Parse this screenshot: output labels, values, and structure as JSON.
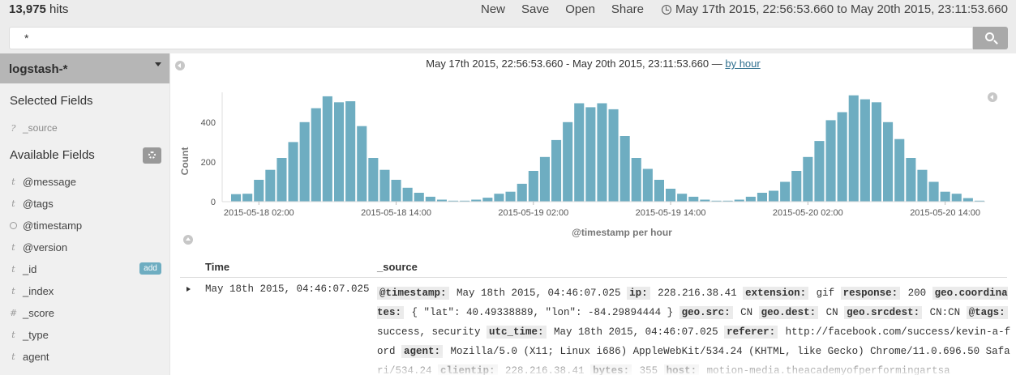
{
  "topbar": {
    "hits_count": "13,975",
    "hits_label": " hits",
    "actions": [
      "New",
      "Save",
      "Open",
      "Share"
    ],
    "time_range": "May 17th 2015, 22:56:53.660 to May 20th 2015, 23:11:53.660"
  },
  "search": {
    "query": "*"
  },
  "sidebar": {
    "index_pattern": "logstash-*",
    "selected_title": "Selected Fields",
    "selected_fields": [
      {
        "type": "?",
        "name": "_source"
      }
    ],
    "available_title": "Available Fields",
    "add_label": "add",
    "fields": [
      {
        "type": "t",
        "name": "@message"
      },
      {
        "type": "t",
        "name": "@tags"
      },
      {
        "type": "clock",
        "name": "@timestamp"
      },
      {
        "type": "t",
        "name": "@version"
      },
      {
        "type": "t",
        "name": "_id"
      },
      {
        "type": "t",
        "name": "_index"
      },
      {
        "type": "#",
        "name": "_score"
      },
      {
        "type": "t",
        "name": "_type"
      },
      {
        "type": "t",
        "name": "agent"
      }
    ]
  },
  "chart_header": {
    "range": "May 17th 2015, 22:56:53.660 - May 20th 2015, 23:11:53.660",
    "separator": " — ",
    "interval": "by hour"
  },
  "chart_data": {
    "type": "bar",
    "color": "#6eadc1",
    "title": "",
    "xlabel": "@timestamp per hour",
    "ylabel": "Count",
    "ylim": [
      0,
      550
    ],
    "yticks": [
      0,
      200,
      400
    ],
    "x_tick_labels": [
      "2015-05-18 02:00",
      "2015-05-18 14:00",
      "2015-05-19 02:00",
      "2015-05-19 14:00",
      "2015-05-20 02:00",
      "2015-05-20 14:00"
    ],
    "x_tick_positions": [
      2,
      14,
      26,
      38,
      50,
      62
    ],
    "values": [
      38,
      40,
      110,
      160,
      220,
      300,
      400,
      470,
      530,
      500,
      505,
      380,
      220,
      160,
      110,
      70,
      45,
      25,
      10,
      5,
      5,
      10,
      20,
      40,
      50,
      90,
      155,
      225,
      310,
      400,
      495,
      475,
      495,
      465,
      330,
      220,
      165,
      110,
      65,
      40,
      25,
      10,
      5,
      5,
      10,
      25,
      45,
      55,
      100,
      155,
      225,
      305,
      410,
      450,
      535,
      515,
      500,
      400,
      315,
      220,
      160,
      100,
      50,
      40,
      18,
      5
    ]
  },
  "table": {
    "col_time": "Time",
    "col_source": "_source",
    "row": {
      "time": "May 18th 2015, 04:46:07.025",
      "source": [
        {
          "k": "@timestamp:",
          "v": "May 18th 2015, 04:46:07.025"
        },
        {
          "k": "ip:",
          "v": "228.216.38.41"
        },
        {
          "k": "extension:",
          "v": "gif"
        },
        {
          "k": "response:",
          "v": "200"
        },
        {
          "k": "geo.coordinates:",
          "v": "{ \"lat\": 40.49338889, \"lon\": -84.29894444 }"
        },
        {
          "k": "geo.src:",
          "v": "CN"
        },
        {
          "k": "geo.dest:",
          "v": "CN"
        },
        {
          "k": "geo.srcdest:",
          "v": "CN:CN"
        },
        {
          "k": "@tags:",
          "v": "success, security"
        },
        {
          "k": "utc_time:",
          "v": "May 18th 2015, 04:46:07.025"
        },
        {
          "k": "referer:",
          "v": "http://facebook.com/success/kevin-a-ford"
        },
        {
          "k": "agent:",
          "v": "Mozilla/5.0 (X11; Linux i686) AppleWebKit/534.24 (KHTML, like Gecko) Chrome/11.0.696.50 Safari/534.24"
        },
        {
          "k": "clientip:",
          "v": "228.216.38.41"
        },
        {
          "k": "bytes:",
          "v": "355"
        },
        {
          "k": "host:",
          "v": "motion-media.theacademyofperformingartsa"
        }
      ]
    }
  }
}
